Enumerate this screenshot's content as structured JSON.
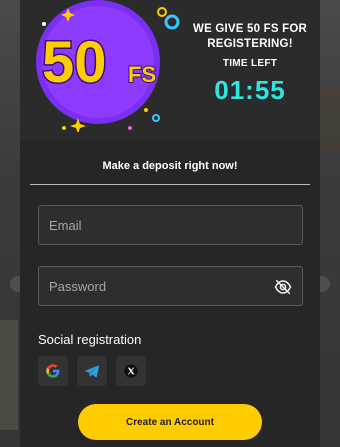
{
  "promo": {
    "badge_amount": "50",
    "badge_unit": "FS",
    "headline": "WE GIVE 50 FS FOR REGISTERING!",
    "time_left_label": "TIME LEFT",
    "timer": "01:55",
    "timer_color": "#2ee6e0",
    "badge_color": "#7b2ff2"
  },
  "form": {
    "cta_text": "Make a deposit right now!",
    "email_placeholder": "Email",
    "password_placeholder": "Password",
    "social_label": "Social registration",
    "social_providers": [
      "google-icon",
      "telegram-icon",
      "x-icon"
    ],
    "submit_label": "Create an Account",
    "accent_color": "#ffcc00"
  }
}
